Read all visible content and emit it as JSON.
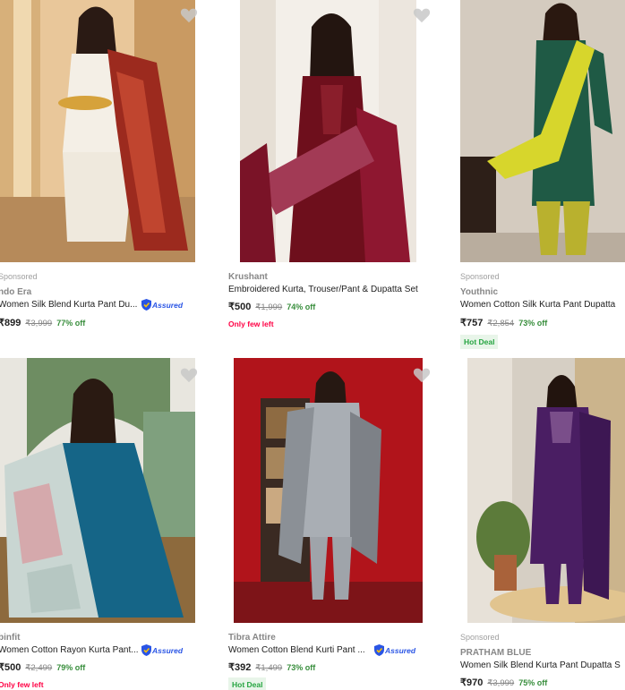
{
  "products": [
    {
      "sponsored": "Sponsored",
      "brand": "ndo Era",
      "title": "Women Silk Blend Kurta Pant Du...",
      "assured": "Assured",
      "price": "₹899",
      "mrp": "₹3,999",
      "off": "77% off",
      "badge": ""
    },
    {
      "sponsored": "",
      "brand": "Krushant",
      "title": "Embroidered Kurta, Trouser/Pant & Dupatta Set",
      "assured": "",
      "price": "₹500",
      "mrp": "₹1,999",
      "off": "74% off",
      "badge": "Only few left"
    },
    {
      "sponsored": "Sponsored",
      "brand": "Youthnic",
      "title": "Women Cotton Silk Kurta Pant Dupatta",
      "assured": "",
      "price": "₹757",
      "mrp": "₹2,854",
      "off": "73% off",
      "badge": "Hot Deal"
    },
    {
      "sponsored": "",
      "brand": "binfit",
      "title": "Women Cotton Rayon Kurta Pant...",
      "assured": "Assured",
      "price": "₹500",
      "mrp": "₹2,499",
      "off": "79% off",
      "badge": "Only few left"
    },
    {
      "sponsored": "",
      "brand": "Tibra Attire",
      "title": "Women Cotton Blend Kurti Pant ...",
      "assured": "Assured",
      "price": "₹392",
      "mrp": "₹1,499",
      "off": "73% off",
      "badge": "Hot Deal"
    },
    {
      "sponsored": "Sponsored",
      "brand": "PRATHAM BLUE",
      "title": "Women Silk Blend Kurta Pant Dupatta S",
      "assured": "",
      "price": "₹970",
      "mrp": "₹3,999",
      "off": "75% off",
      "badge": ""
    }
  ],
  "icons": {
    "wishlist": "heart-icon",
    "assured": "shield-icon"
  },
  "colors": {
    "offer": "#388e3c",
    "few_left": "#ff0044",
    "hot_deal": "#26a541",
    "assured": "#2a55e5"
  }
}
